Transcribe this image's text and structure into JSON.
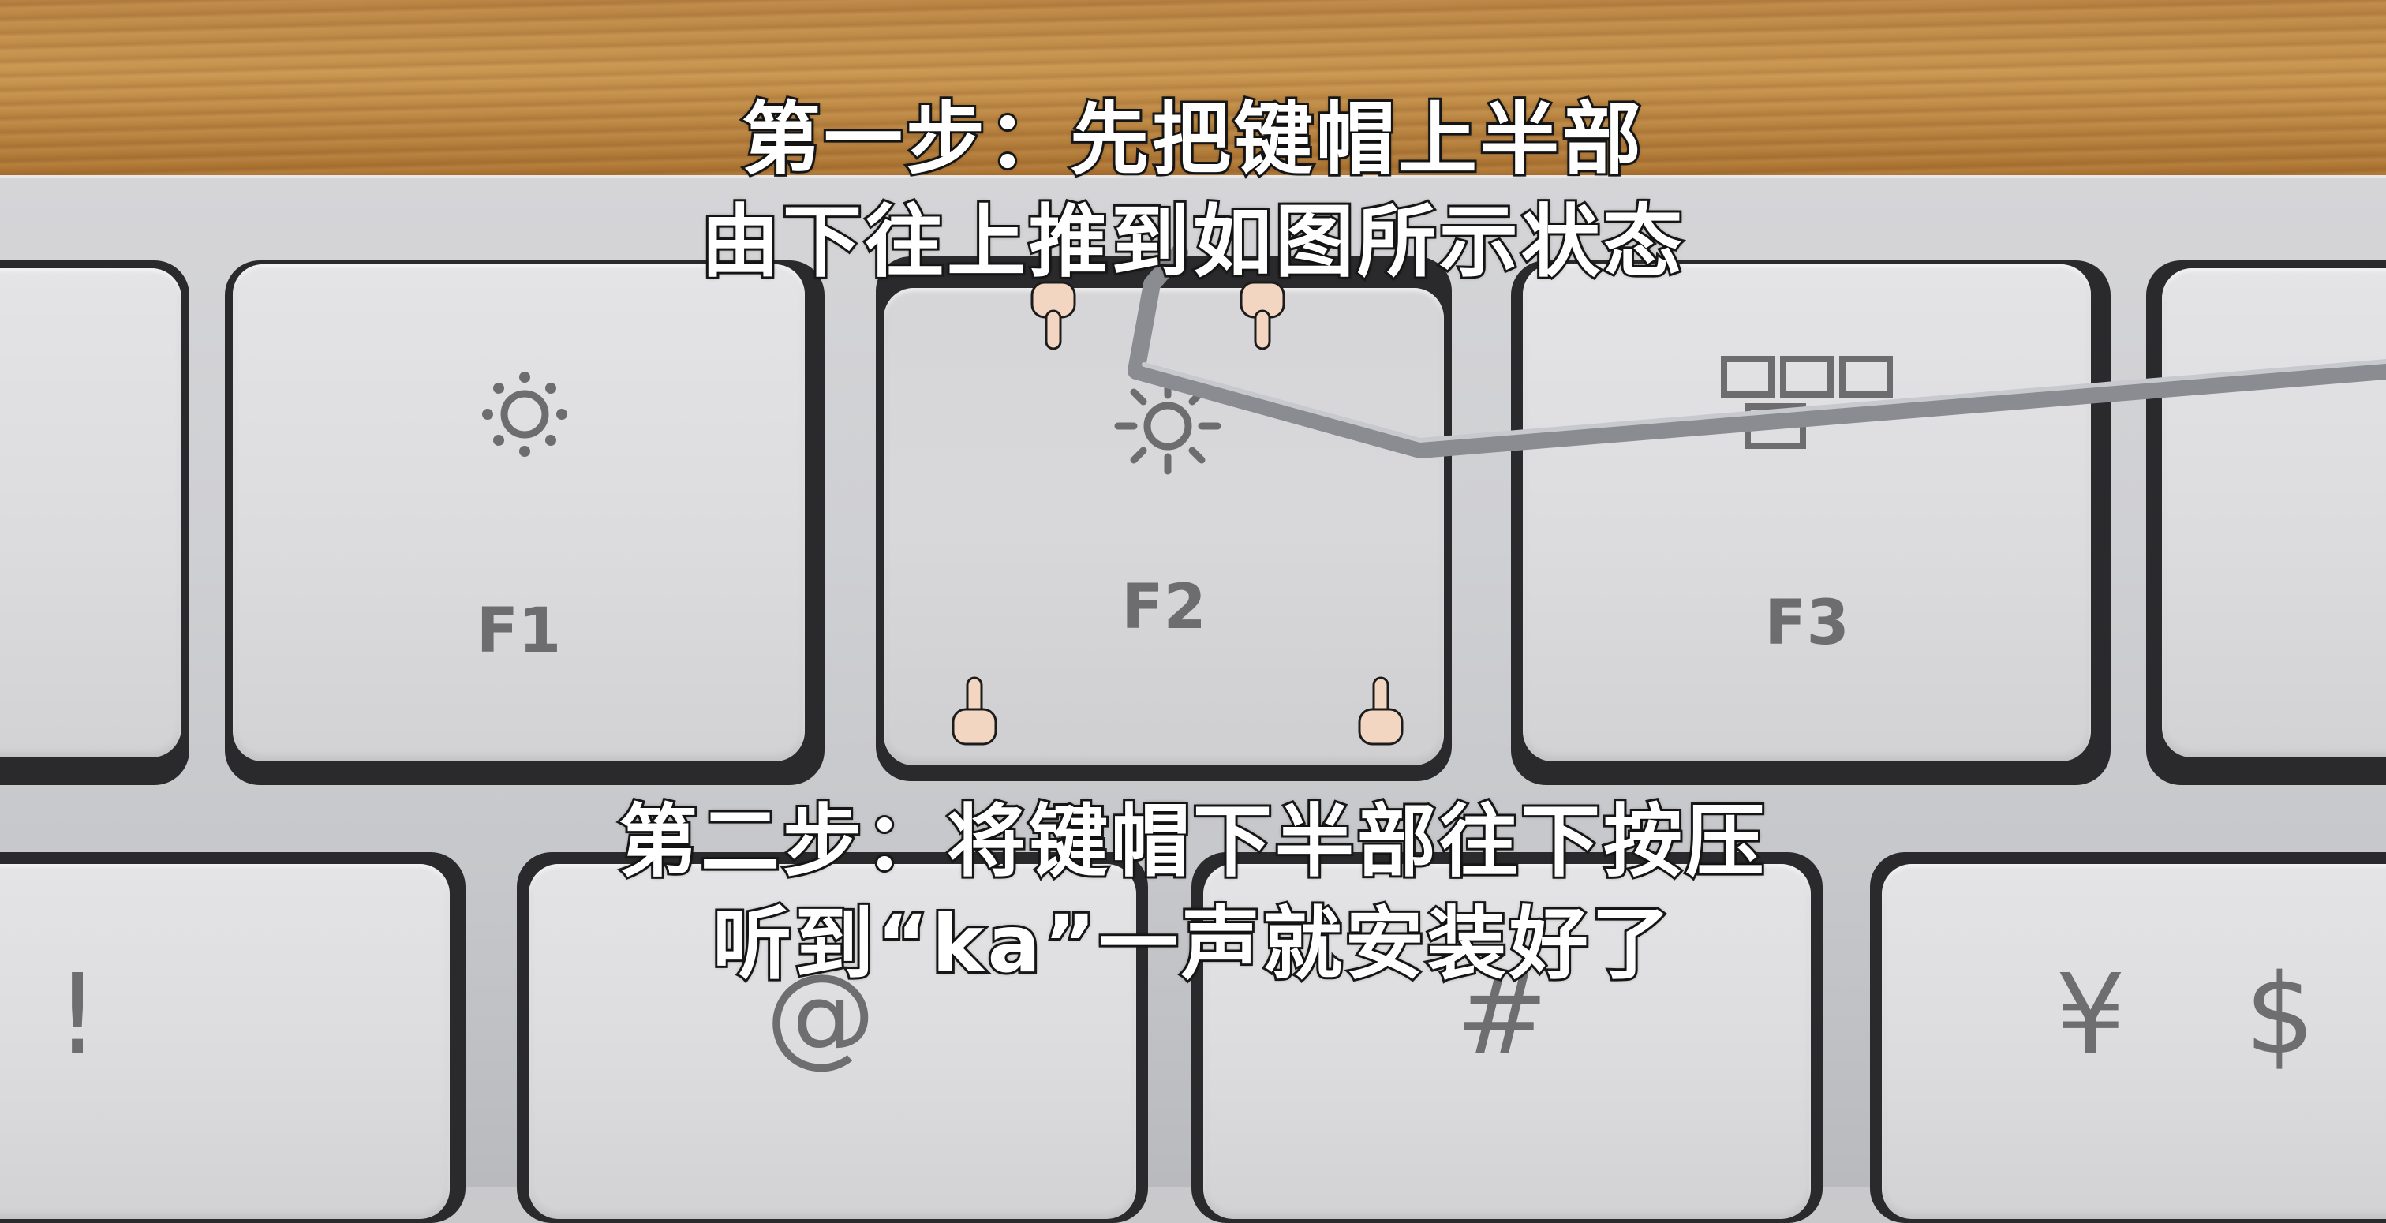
{
  "captions": {
    "step1_line1": "第一步：先把键帽上半部",
    "step1_line2": "由下往上推到如图所示状态",
    "step2_line1": "第二步：将键帽下半部往下按压",
    "step2_line2": "听到“ka”一声就安装好了"
  },
  "keys": {
    "f1": "F1",
    "f2": "F2",
    "f3": "F3",
    "exclaim": "!",
    "at": "@",
    "hash": "#",
    "yen": "¥",
    "dollar": "$"
  },
  "icons": {
    "f1_icon": "brightness-down-icon",
    "f2_icon": "brightness-up-icon",
    "f3_icon": "mission-control-icon",
    "pointer_down": "hand-pointing-down-icon",
    "pointer_up": "hand-pointing-up-icon"
  },
  "colors": {
    "caption_fill": "#ffffff",
    "caption_stroke": "#1c1c1c",
    "key_cap": "#dcdcde",
    "legend": "#6d6d70",
    "wood": "#b98443"
  }
}
